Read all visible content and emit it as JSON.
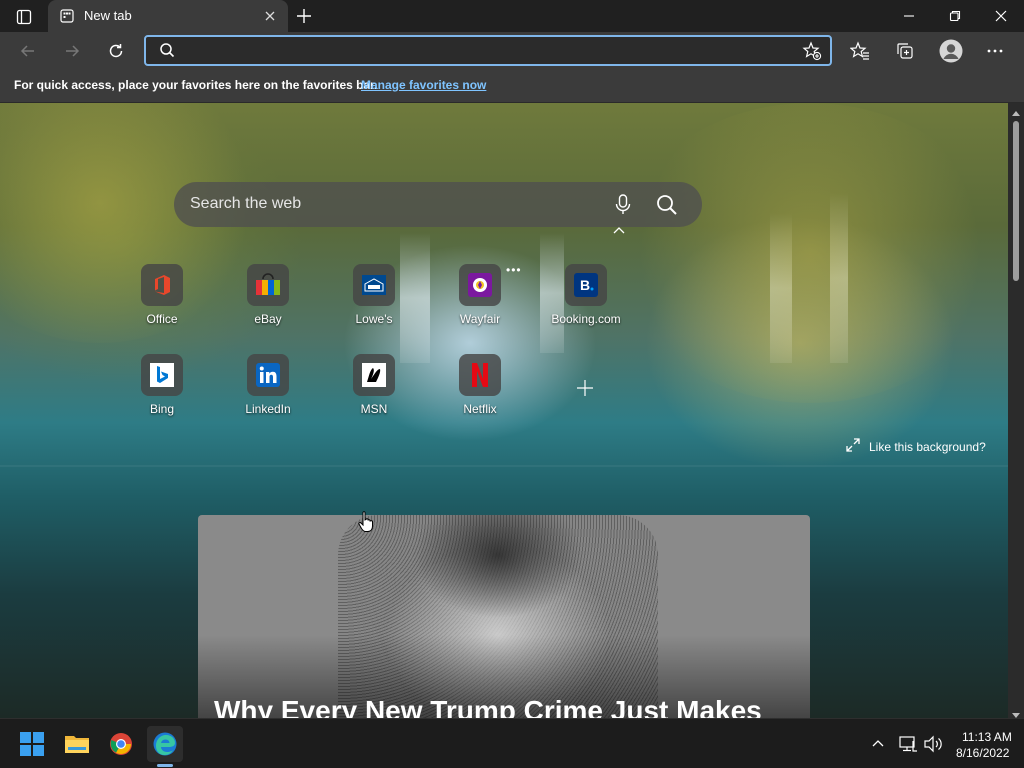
{
  "browser": {
    "tab": {
      "title": "New tab"
    },
    "address_bar": {
      "value": "",
      "placeholder": ""
    },
    "favorites_bar": {
      "message": "For quick access, place your favorites here on the favorites bar.",
      "link": "Manage favorites now"
    },
    "accent_color": "#7fb6ea"
  },
  "newtab": {
    "search": {
      "placeholder": "Search the web"
    },
    "quick_links": [
      {
        "label": "Office",
        "icon": "office-icon",
        "color": "#e8472b"
      },
      {
        "label": "eBay",
        "icon": "ebay-icon",
        "color": "#0064d2"
      },
      {
        "label": "Lowe's",
        "icon": "lowes-icon",
        "color": "#004990"
      },
      {
        "label": "Wayfair",
        "icon": "wayfair-icon",
        "color": "#7b189f"
      },
      {
        "label": "Booking.com",
        "icon": "booking-icon",
        "color": "#003580"
      },
      {
        "label": "Bing",
        "icon": "bing-icon",
        "color": "#0078d4"
      },
      {
        "label": "LinkedIn",
        "icon": "linkedin-icon",
        "color": "#0a66c2"
      },
      {
        "label": "MSN",
        "icon": "msn-icon",
        "color": "#000000"
      },
      {
        "label": "Netflix",
        "icon": "netflix-icon",
        "color": "#e50914"
      }
    ],
    "like_background": "Like this background?",
    "news": {
      "headline": "Why Every New Trump Crime Just Makes"
    }
  },
  "taskbar": {
    "apps": [
      "start-icon",
      "file-explorer-icon",
      "chrome-icon",
      "edge-icon"
    ],
    "time": "11:13 AM",
    "date": "8/16/2022"
  }
}
